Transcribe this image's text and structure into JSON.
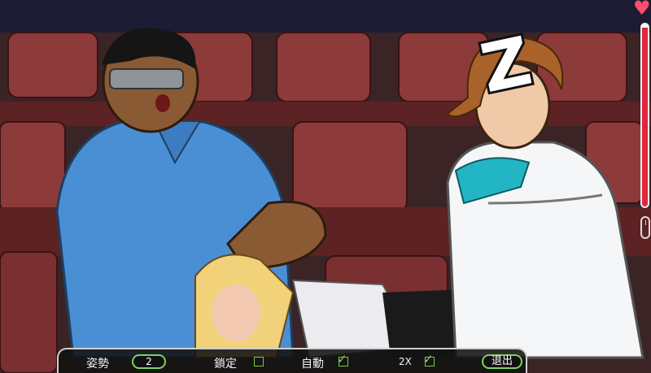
{
  "scene": {
    "zz_glyph": "Z",
    "colors": {
      "seat": "#8c3a3a",
      "seat_dark": "#5c2224",
      "shirt": "#4a8fd4",
      "jacket_trim": "#22b6c4"
    }
  },
  "hud": {
    "pose_label": "姿勢",
    "pose_value": "2",
    "lock_label": "鎖定",
    "auto_label": "自動",
    "speed_label": "2X",
    "exit_label": "退出"
  },
  "meter": {
    "level_percent": 98
  }
}
